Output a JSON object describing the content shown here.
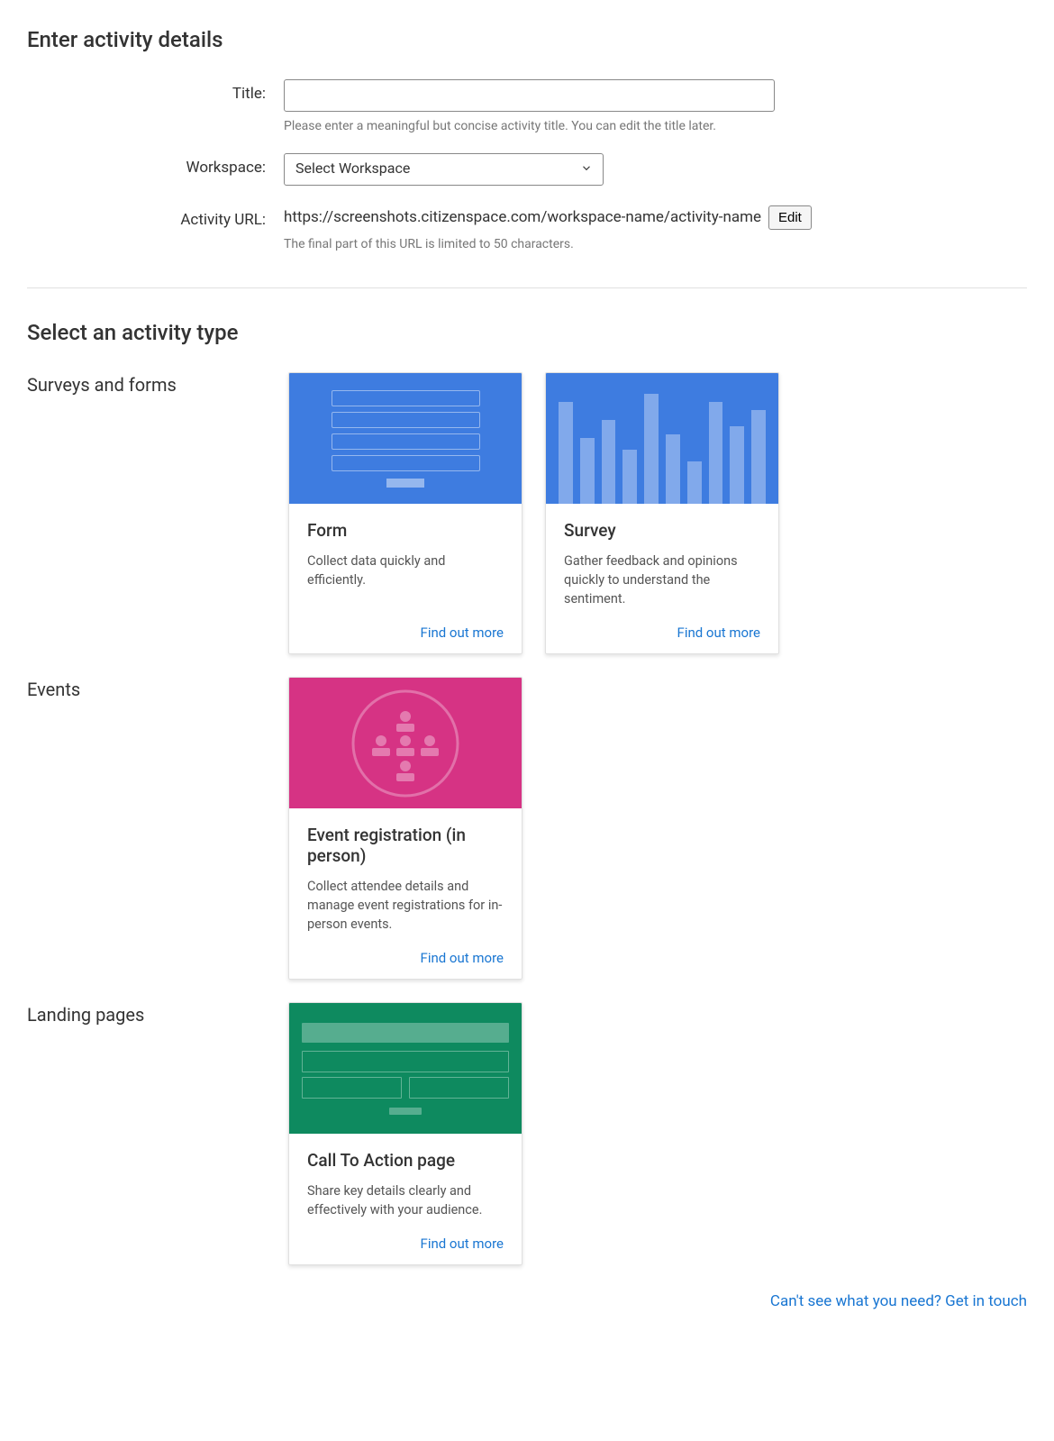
{
  "section1_title": "Enter activity details",
  "title_label": "Title:",
  "title_help": "Please enter a meaningful but concise activity title. You can edit the title later.",
  "workspace_label": "Workspace:",
  "workspace_placeholder": "Select Workspace",
  "url_label": "Activity URL:",
  "url_value": "https://screenshots.citizenspace.com/workspace-name/activity-name",
  "edit_label": "Edit",
  "url_help": "The final part of this URL is limited to 50 characters.",
  "section2_title": "Select an activity type",
  "groups": {
    "surveys": {
      "label": "Surveys and forms",
      "form": {
        "title": "Form",
        "desc": "Collect data quickly and efficiently.",
        "link": "Find out more"
      },
      "survey": {
        "title": "Survey",
        "desc": "Gather feedback and opinions quickly to understand the sentiment.",
        "link": "Find out more"
      }
    },
    "events": {
      "label": "Events",
      "event": {
        "title": "Event registration (in person)",
        "desc": "Collect attendee details and manage event registrations for in-person events.",
        "link": "Find out more"
      }
    },
    "landing": {
      "label": "Landing pages",
      "cta": {
        "title": "Call To Action page",
        "desc": "Share key details clearly and effectively with your audience.",
        "link": "Find out more"
      }
    }
  },
  "footer_link": "Can't see what you need? Get in touch"
}
